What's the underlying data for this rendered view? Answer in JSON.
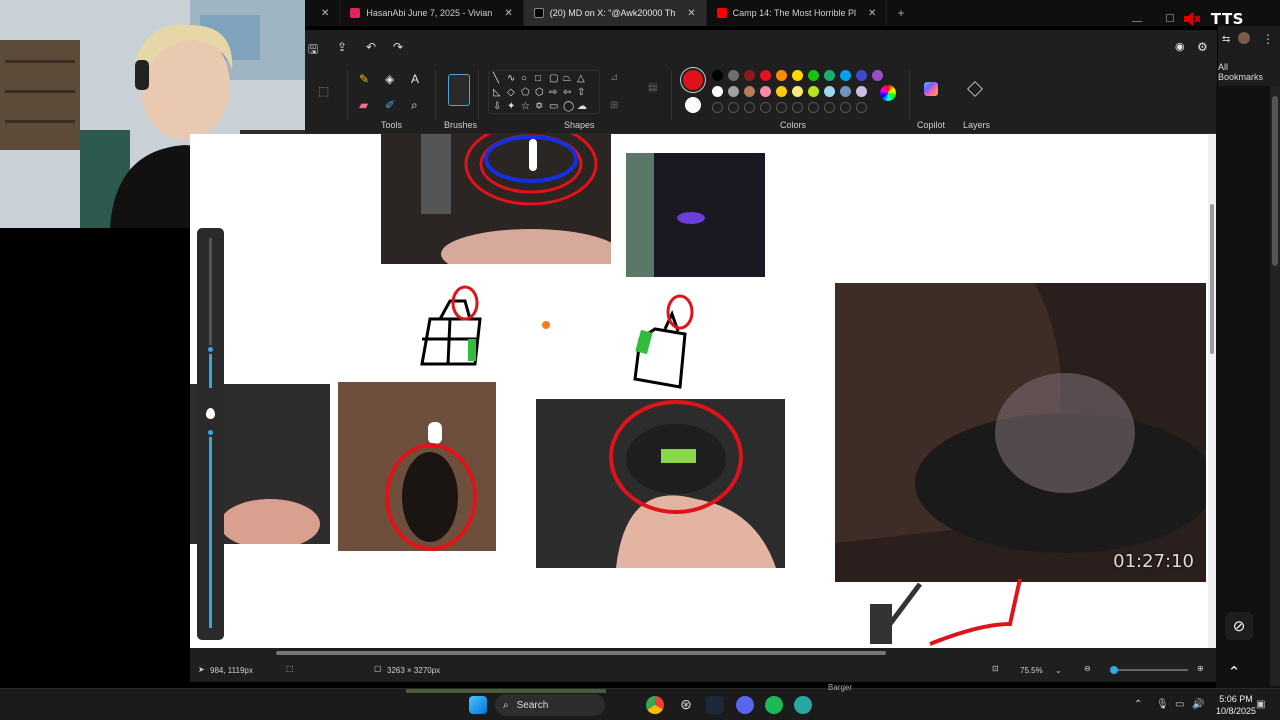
{
  "browser": {
    "tabs": [
      {
        "label": "HasanAbi June 7, 2025 - Vivian",
        "active": false
      },
      {
        "label": "(20) MD on X: \"@Awk20000 Th",
        "active": true
      },
      {
        "label": "Camp 14: The Most Horrible Pl",
        "active": false
      }
    ],
    "overlay_text": "TTS",
    "bookmarks_label": "All Bookmarks"
  },
  "paint": {
    "groups": {
      "tools": "Tools",
      "brushes": "Brushes",
      "shapes": "Shapes",
      "colors": "Colors",
      "copilot": "Copilot",
      "layers": "Layers"
    },
    "selected_color": "#e0131a",
    "secondary_color": "#ffffff",
    "palette_row1": [
      "#000000",
      "#6e6e6e",
      "#8c1b1b",
      "#e81123",
      "#ff8c00",
      "#ffd800",
      "#16c60c",
      "#19b06a",
      "#00a2ed",
      "#3f48cc",
      "#9b4dca"
    ],
    "palette_row2": [
      "#ffffff",
      "#a0a0a0",
      "#b97a57",
      "#ff8aa8",
      "#ffc90e",
      "#ffe97f",
      "#b5e61d",
      "#99d9ea",
      "#7092be",
      "#c8bfe7"
    ],
    "timecode": "01:27:10",
    "status": {
      "cursor_pos": "984, 1119px",
      "canvas_size": "3263 × 3270px",
      "zoom": "75.5%"
    }
  },
  "taskbar": {
    "search_placeholder": "Search",
    "time": "5:06 PM",
    "date": "10/8/2025",
    "peek_label": "Barger"
  }
}
